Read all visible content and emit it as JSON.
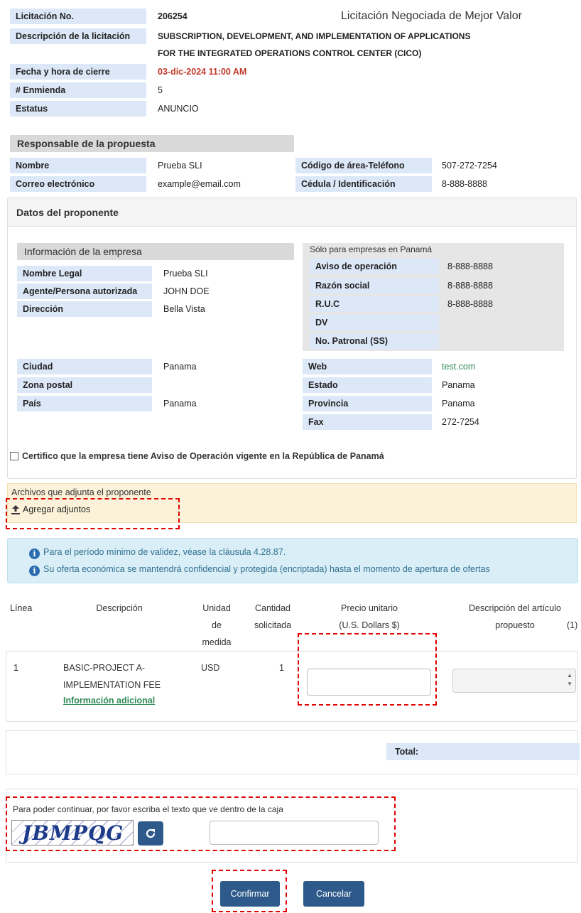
{
  "header": {
    "licitacion_label": "Licitación No.",
    "licitacion_value": "206254",
    "tipo": "Licitación Negociada de Mejor Valor",
    "descripcion_label": "Descripción de la licitación",
    "descripcion_line1": "SUBSCRIPTION, DEVELOPMENT, AND IMPLEMENTATION OF APPLICATIONS",
    "descripcion_line2": "FOR THE INTEGRATED OPERATIONS CONTROL CENTER (CICO)",
    "cierre_label": "Fecha y hora de cierre",
    "cierre_value": "03-dic-2024 11:00 AM",
    "enmienda_label": "# Enmienda",
    "enmienda_value": "5",
    "estatus_label": "Estatus",
    "estatus_value": "ANUNCIO"
  },
  "responsable": {
    "title": "Responsable de la propuesta",
    "nombre_label": "Nombre",
    "nombre_value": "Prueba SLI",
    "telefono_label": "Código de área-Teléfono",
    "telefono_value": "507-272-7254",
    "correo_label": "Correo electrónico",
    "correo_value": "example@email.com",
    "cedula_label": "Cédula / Identificación",
    "cedula_value": "8-888-8888"
  },
  "proponente": {
    "title": "Datos del proponente",
    "empresa_title": "Información de la empresa",
    "nombre_legal_label": "Nombre Legal",
    "nombre_legal_value": "Prueba SLI",
    "agente_label": "Agente/Persona autorizada",
    "agente_value": "JOHN DOE",
    "direccion_label": "Dirección",
    "direccion_value": "Bella Vista",
    "ciudad_label": "Ciudad",
    "ciudad_value": "Panama",
    "zona_label": "Zona postal",
    "zona_value": "",
    "pais_label": "País",
    "pais_value": "Panama",
    "panama_title": "Sólo para empresas en Panamá",
    "aviso_label": "Aviso de operación",
    "aviso_value": "8-888-8888",
    "razon_label": "Razón social",
    "razon_value": "8-888-8888",
    "ruc_label": "R.U.C",
    "ruc_value": "8-888-8888",
    "dv_label": "DV",
    "dv_value": "",
    "patronal_label": "No. Patronal (SS)",
    "patronal_value": "",
    "web_label": "Web",
    "web_value": "test.com",
    "estado_label": "Estado",
    "estado_value": "Panama",
    "provincia_label": "Provincia",
    "provincia_value": "Panama",
    "fax_label": "Fax",
    "fax_value": "272-7254",
    "certifico_label": "Certifico que la empresa tiene Aviso de Operación vigente en la República de Panamá"
  },
  "adjuntos": {
    "title": "Archivos que adjunta el proponente",
    "agregar_label": "Agregar adjuntos"
  },
  "info": {
    "line1": "Para el período mínimo de validez, véase la cláusula 4.28.87.",
    "line2": "Su oferta económica se mantendrá confidencial y protegida (encriptada) hasta el momento de apertura de ofertas"
  },
  "table": {
    "col_linea": "Línea",
    "col_descripcion": "Descripción",
    "col_unidad_1": "Unidad",
    "col_unidad_2": "de",
    "col_unidad_3": "medida",
    "col_cantidad_1": "Cantidad",
    "col_cantidad_2": "solicitada",
    "col_precio_1": "Precio unitario",
    "col_precio_2": "(U.S. Dollars $)",
    "col_articulo_1": "Descripción del artículo",
    "col_articulo_2": "propuesto",
    "col_articulo_note": "(1)",
    "rows": [
      {
        "linea": "1",
        "desc_1": "BASIC-PROJECT A-",
        "desc_2": "IMPLEMENTATION FEE",
        "info_link": "Información adicional",
        "unidad": "USD",
        "cantidad": "1",
        "precio": "",
        "articulo": ""
      }
    ],
    "total_label": "Total:"
  },
  "captcha": {
    "instruction": "Para poder continuar, por favor escriba el texto que ve dentro de la caja",
    "text": "JBMPQG",
    "input_value": ""
  },
  "actions": {
    "confirmar": "Confirmar",
    "cancelar": "Cancelar"
  },
  "icons": {
    "info": "info-circle-icon",
    "upload": "upload-icon",
    "refresh": "refresh-icon",
    "checkbox": "checkbox-icon",
    "spinner": "spinner-arrows-icon"
  },
  "colors": {
    "label_bg": "#dce8f8",
    "section_header_bg": "#d9d9d9",
    "attachments_bg": "#fcf2d9",
    "info_bg": "#d9eef7",
    "button_bg": "#2d5a8a",
    "date_red": "#c0392b",
    "link_green": "#2e8b57",
    "highlight_red": "#e00000"
  }
}
